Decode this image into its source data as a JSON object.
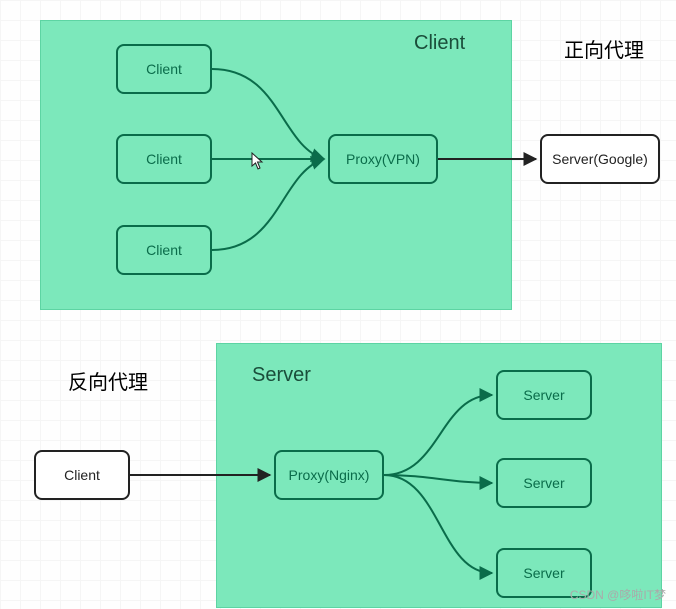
{
  "diagram1": {
    "region_label": "Client",
    "outside_label": "正向代理",
    "clients": [
      "Client",
      "Client",
      "Client"
    ],
    "proxy": "Proxy(VPN)",
    "server": "Server(Google)"
  },
  "diagram2": {
    "region_label": "Server",
    "outside_label": "反向代理",
    "client": "Client",
    "proxy": "Proxy(Nginx)",
    "servers": [
      "Server",
      "Server",
      "Server"
    ]
  },
  "watermark": "CSDN @哆啦IT梦",
  "colors": {
    "region_fill": "#7ce8bb",
    "box_green": "#0a6c4a",
    "box_black": "#222222"
  }
}
